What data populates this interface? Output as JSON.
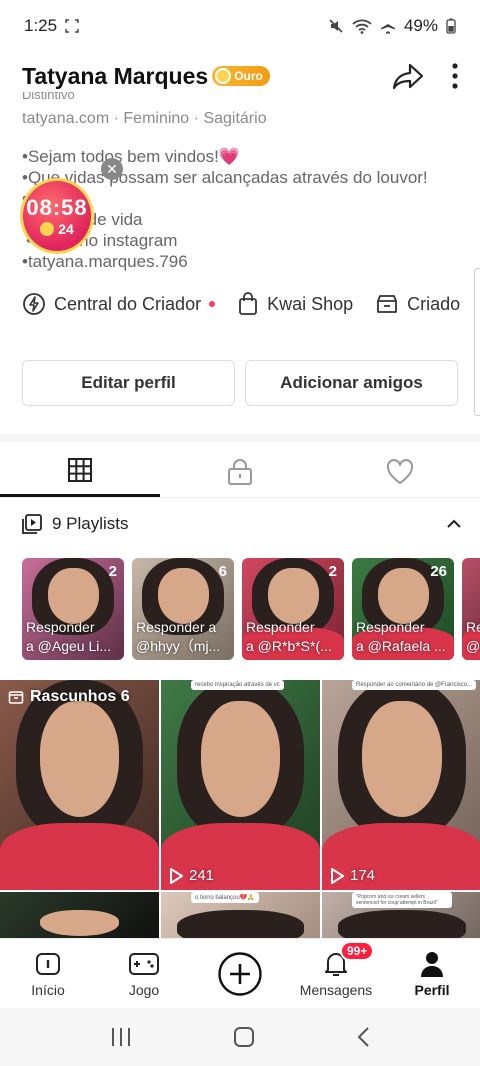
{
  "status": {
    "time": "1:25",
    "battery": "49%"
  },
  "profile": {
    "name": "Tatyana Marques",
    "badge": "Ouro",
    "cutoff_line": "Distintivo",
    "meta": [
      "tatyana.com",
      "Feminino",
      "Sagitário"
    ],
    "bio": [
      "•Sejam todos bem vindos!💗",
      "•Que vidas possam ser alcançadas através do louvor!",
      "•",
      "•... istro de vida",
      "•... am no instagram",
      "•tatyana.marques.796"
    ]
  },
  "live_widget": {
    "timer": "08:58",
    "coins": "24"
  },
  "creator_tools": [
    {
      "label": "Central do Criador",
      "icon": "bolt-icon"
    },
    {
      "label": "Kwai Shop",
      "icon": "shopping-bag-icon"
    },
    {
      "label": "Criado",
      "icon": "store-icon"
    }
  ],
  "buttons": {
    "edit": "Editar perfil",
    "add": "Adicionar amigos"
  },
  "tabs": [
    {
      "name": "grid-icon"
    },
    {
      "name": "lock-icon"
    },
    {
      "name": "heart-icon"
    }
  ],
  "playlists": {
    "header": "9 Playlists",
    "items": [
      {
        "count": "2",
        "line1": "Responder",
        "line2": "a @Ageu Li..."
      },
      {
        "count": "6",
        "line1": "Responder a",
        "line2": "@hhyy（mj..."
      },
      {
        "count": "2",
        "line1": "Responder",
        "line2": "a @R*b*S*(..."
      },
      {
        "count": "26",
        "line1": "Responder",
        "line2": "a @Rafaela ..."
      },
      {
        "count": "",
        "line1": "Re",
        "line2": "@V"
      }
    ]
  },
  "grid": {
    "drafts_label": "Rascunhos 6",
    "items": [
      {
        "views": "",
        "tip": ""
      },
      {
        "views": "241",
        "tip": "recebo inspiração através de vc"
      },
      {
        "views": "174",
        "tip": "Responder ao comentário de @Francisco..."
      },
      {
        "views": "",
        "tip": ""
      },
      {
        "views": "",
        "tip": "o tiorro balançou💔🙏"
      },
      {
        "views": "",
        "tip": "\"Popcorn and ice cream sellers sentenced for coup attempt in Brazil\""
      }
    ]
  },
  "nav": [
    {
      "label": "Início",
      "icon": "home-icon"
    },
    {
      "label": "Jogo",
      "icon": "gamepad-icon"
    },
    {
      "label": "",
      "icon": "plus-circle-icon"
    },
    {
      "label": "Mensagens",
      "icon": "bell-icon",
      "badge": "99+"
    },
    {
      "label": "Perfil",
      "icon": "person-icon"
    }
  ]
}
